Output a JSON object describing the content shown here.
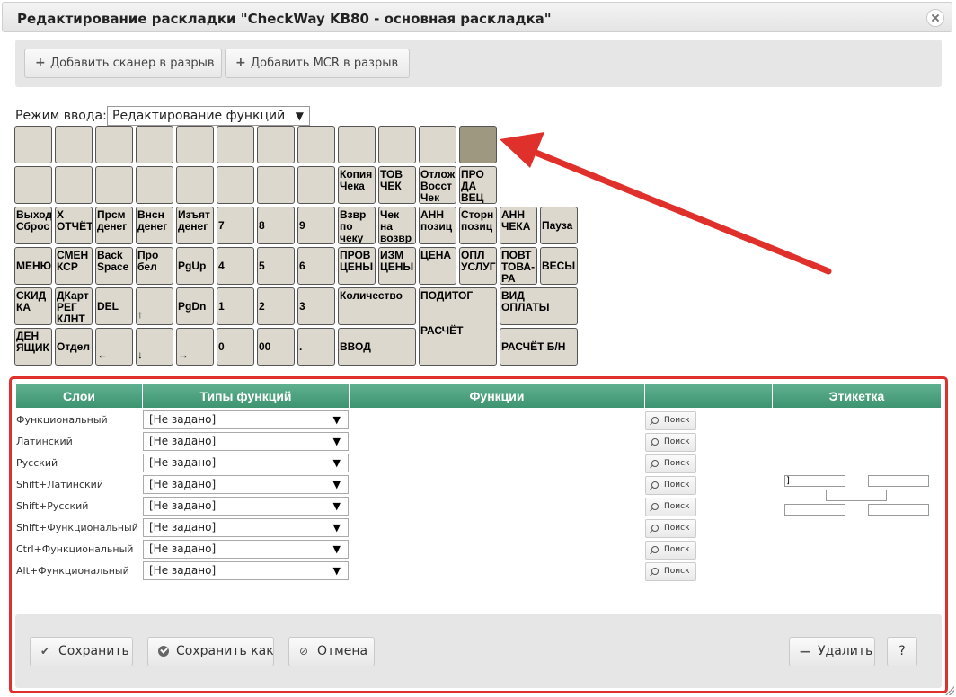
{
  "window": {
    "title": "Редактирование раскладки \"CheckWay KB80 - основная раскладка\""
  },
  "toolbar": {
    "add_scanner_label": "Добавить сканер в разрыв",
    "add_mcr_label": "Добавить MCR в разрыв"
  },
  "mode": {
    "label": "Режим ввода:",
    "value": "Редактирование функций"
  },
  "keyboard": {
    "keys": [
      {
        "t": ""
      },
      {
        "t": ""
      },
      {
        "t": ""
      },
      {
        "t": ""
      },
      {
        "t": ""
      },
      {
        "t": ""
      },
      {
        "t": ""
      },
      {
        "t": ""
      },
      {
        "t": ""
      },
      {
        "t": ""
      },
      {
        "t": ""
      },
      {
        "t": "",
        "selected": true
      },
      {
        "t": ""
      },
      {
        "t": ""
      },
      {
        "t": ""
      },
      {
        "t": ""
      },
      {
        "t": ""
      },
      {
        "t": ""
      },
      {
        "t": ""
      },
      {
        "t": ""
      },
      {
        "t": "Копия\nЧека"
      },
      {
        "t": "ТОВ\nЧЕК"
      },
      {
        "t": "Отлож\nВосст\nЧек"
      },
      {
        "t": "ПРО\nДА\nВЕЦ"
      },
      {
        "t": "Выход\nСброс"
      },
      {
        "t": "Х\nОТЧЁТ"
      },
      {
        "t": "Прсм\nденег"
      },
      {
        "t": "Внсн\nденег"
      },
      {
        "t": "Изъят\nденег"
      },
      {
        "t": "7"
      },
      {
        "t": "8"
      },
      {
        "t": "9"
      },
      {
        "t": "Взвр\nпо\nчеку"
      },
      {
        "t": "Чек\nна\nвозвр"
      },
      {
        "t": "АНН\nпозиц"
      },
      {
        "t": "Сторн\nпозиц"
      },
      {
        "t": "АНН\nЧЕКА"
      },
      {
        "t": "Пауза"
      },
      {
        "t": "МЕНЮ"
      },
      {
        "t": "СМЕН\nКСР"
      },
      {
        "t": "Back\nSpace"
      },
      {
        "t": "Про\nбел"
      },
      {
        "t": "PgUp"
      },
      {
        "t": "4"
      },
      {
        "t": "5"
      },
      {
        "t": "6"
      },
      {
        "t": "ПРОВ\nЦЕНЫ"
      },
      {
        "t": "ИЗМ\nЦЕНЫ"
      },
      {
        "t": "ЦЕНА"
      },
      {
        "t": "ОПЛ\nУСЛУГ"
      },
      {
        "t": "ПОВТ\nТОВА-\nРА"
      },
      {
        "t": "ВЕСЫ"
      },
      {
        "t": "СКИД\nКА"
      },
      {
        "t": "ДКарт\nРЕГ\nКЛНТ"
      },
      {
        "t": "DEL"
      },
      {
        "t": "↑"
      },
      {
        "t": "PgDn"
      },
      {
        "t": "1"
      },
      {
        "t": "2"
      },
      {
        "t": "3"
      },
      {
        "t": "Количество"
      },
      {
        "t": "ПОДИТОГ\n\n\nРАСЧЁТ"
      },
      {
        "t": "ВИД\nОПЛАТЫ"
      },
      {
        "t": "ДЕН\nЯЩИК"
      },
      {
        "t": "Отдел"
      },
      {
        "t": "←"
      },
      {
        "t": "↓"
      },
      {
        "t": "→"
      },
      {
        "t": "0"
      },
      {
        "t": "00"
      },
      {
        "t": "."
      },
      {
        "t": "ВВОД"
      },
      {
        "t": "РАСЧЁТ Б/Н"
      }
    ]
  },
  "table": {
    "headers": {
      "layers": "Слои",
      "types": "Типы функций",
      "functions": "Функции",
      "blank": "",
      "label": "Этикетка"
    },
    "rows": [
      {
        "layer": "Функциональный",
        "type": "[Не задано]",
        "search": "Поиск"
      },
      {
        "layer": "Латинский",
        "type": "[Не задано]",
        "search": "Поиск"
      },
      {
        "layer": "Русский",
        "type": "[Не задано]",
        "search": "Поиск"
      },
      {
        "layer": "Shift+Латинский",
        "type": "[Не задано]",
        "search": "Поиск"
      },
      {
        "layer": "Shift+Русский",
        "type": "[Не задано]",
        "search": "Поиск"
      },
      {
        "layer": "Shift+Функциональный",
        "type": "[Не задано]",
        "search": "Поиск"
      },
      {
        "layer": "Ctrl+Функциональный",
        "type": "[Не задано]",
        "search": "Поиск"
      },
      {
        "layer": "Alt+Функциональный",
        "type": "[Не задано]",
        "search": "Поиск"
      }
    ],
    "label_fields": [
      "]",
      "",
      "",
      "",
      ""
    ]
  },
  "footer": {
    "save": "Сохранить",
    "save_as": "Сохранить как",
    "cancel": "Отмена",
    "delete": "Удалить",
    "help": "?"
  },
  "colors": {
    "accent": "#e0302b",
    "header_green": "#4aa07c",
    "key_bg": "#dcd8ce",
    "key_selected": "#9e9880"
  }
}
